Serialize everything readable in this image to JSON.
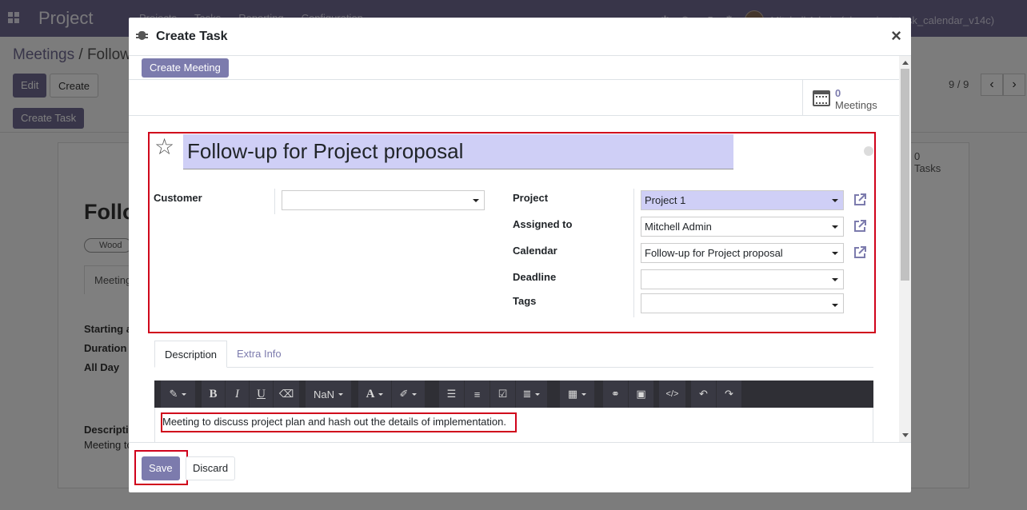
{
  "topbar": {
    "app_name": "Project",
    "menu": [
      "Projects",
      "Tasks",
      "Reporting",
      "Configuration"
    ],
    "messages_count": "5",
    "user": "Mitchell Admin (ob_project_task_calendar_v14c)"
  },
  "background": {
    "breadcrumb_parent": "Meetings",
    "breadcrumb_sep": "/",
    "breadcrumb_current": "Follow-",
    "edit_label": "Edit",
    "create_label": "Create",
    "create_task_label": "Create Task",
    "pager": "9 / 9",
    "record_title": "Follo",
    "tag": "Wood",
    "tab_label": "Meeting",
    "labels": [
      "Starting a",
      "Duration",
      "All Day"
    ],
    "desc_label": "Descripti",
    "desc_text": "Meeting to",
    "tasks_count": "0",
    "tasks_label": "Tasks"
  },
  "modal": {
    "title": "Create Task",
    "close": "×",
    "create_meeting_label": "Create Meeting",
    "meetings_count": "0",
    "meetings_label": "Meetings",
    "task_name": "Follow-up for Project proposal",
    "fields": {
      "customer_label": "Customer",
      "customer_value": "",
      "project_label": "Project",
      "project_value": "Project 1",
      "assigned_label": "Assigned to",
      "assigned_value": "Mitchell Admin",
      "calendar_label": "Calendar",
      "calendar_value": "Follow-up for Project proposal",
      "deadline_label": "Deadline",
      "deadline_value": "",
      "tags_label": "Tags",
      "tags_value": ""
    },
    "tabs": [
      "Description",
      "Extra Info"
    ],
    "toolbar": {
      "font_size": "NaN"
    },
    "description": "Meeting to discuss project plan and hash out the details of implementation.",
    "save_label": "Save",
    "discard_label": "Discard"
  },
  "colors": {
    "brand": "#706b93",
    "primary_button": "#7c7bad",
    "highlight_border": "#d0021b",
    "active_field": "#cfcff6"
  }
}
